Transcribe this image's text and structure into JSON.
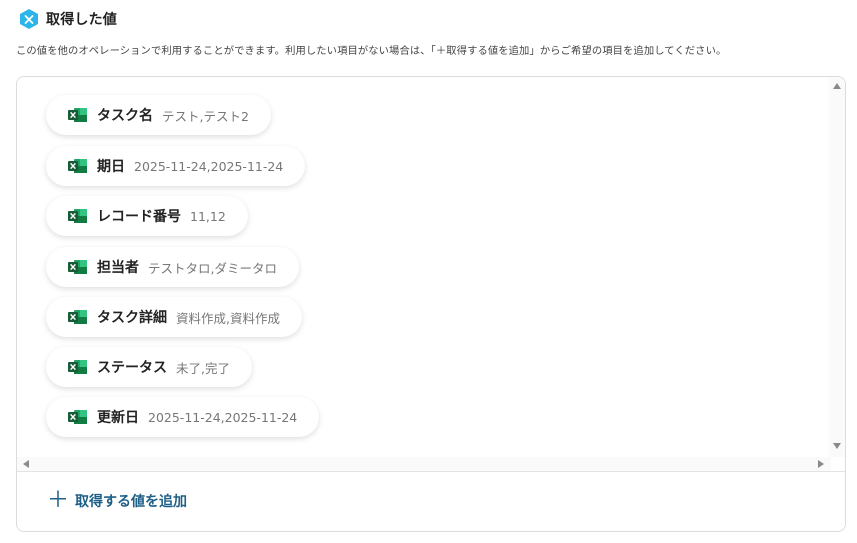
{
  "section": {
    "title": "取得した値",
    "description": "この値を他のオペレーションで利用することができます。利用したい項目がない場合は、「＋取得する値を追加」からご希望の項目を追加してください。"
  },
  "values": [
    {
      "name": "タスク名",
      "value": "テスト,テスト2"
    },
    {
      "name": "期日",
      "value": "2025-11-24,2025-11-24"
    },
    {
      "name": "レコード番号",
      "value": "11,12"
    },
    {
      "name": "担当者",
      "value": "テストタロ,ダミータロ"
    },
    {
      "name": "タスク詳細",
      "value": "資料作成,資料作成"
    },
    {
      "name": "ステータス",
      "value": "未了,完了"
    },
    {
      "name": "更新日",
      "value": "2025-11-24,2025-11-24"
    }
  ],
  "add_button": {
    "icon": "plus",
    "label": "取得する値を追加"
  },
  "colors": {
    "accent": "#1d5f86",
    "header_icon": "#2cb5e8",
    "excel_green": "#1e7145"
  },
  "icons": {
    "header": "hexagon-x-icon",
    "chip": "excel-icon"
  }
}
